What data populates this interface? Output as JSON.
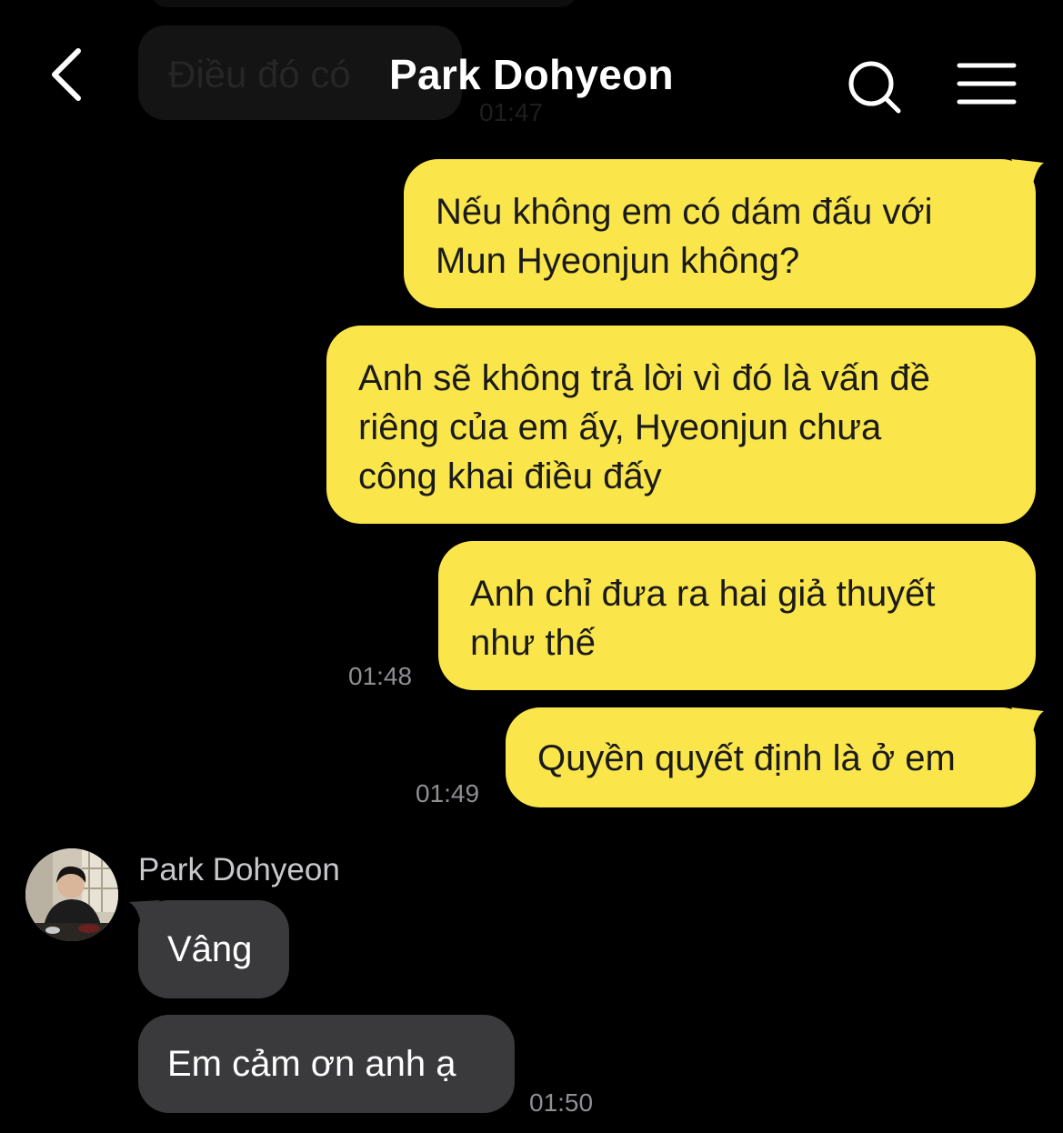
{
  "header": {
    "title": "Park Dohyeon",
    "back_icon": "chevron-left-icon",
    "search_icon": "search-icon",
    "menu_icon": "hamburger-menu-icon"
  },
  "faded_message": {
    "text": "Điều đó có ",
    "time": "01:47"
  },
  "outgoing": [
    {
      "lines": [
        "Nếu không em có dám đấu với",
        "Mun Hyeonjun không?"
      ],
      "time": ""
    },
    {
      "lines": [
        "Anh sẽ không trả lời vì đó là vấn đề",
        "riêng của em ấy, Hyeonjun chưa",
        "công khai điều đấy"
      ],
      "time": ""
    },
    {
      "lines": [
        "Anh chỉ đưa ra hai giả thuyết",
        "như thế"
      ],
      "time": "01:48"
    },
    {
      "lines": [
        "Quyền quyết định là ở em"
      ],
      "time": "01:49"
    }
  ],
  "incoming": {
    "sender": "Park Dohyeon",
    "messages": [
      {
        "text": "Vâng",
        "time": ""
      },
      {
        "text": "Em cảm ơn anh ạ",
        "time": "01:50"
      }
    ]
  },
  "colors": {
    "outgoing_bubble": "#fae54b",
    "incoming_bubble": "#3a3a3c",
    "background": "#000000",
    "timestamp": "#8e8e93"
  }
}
